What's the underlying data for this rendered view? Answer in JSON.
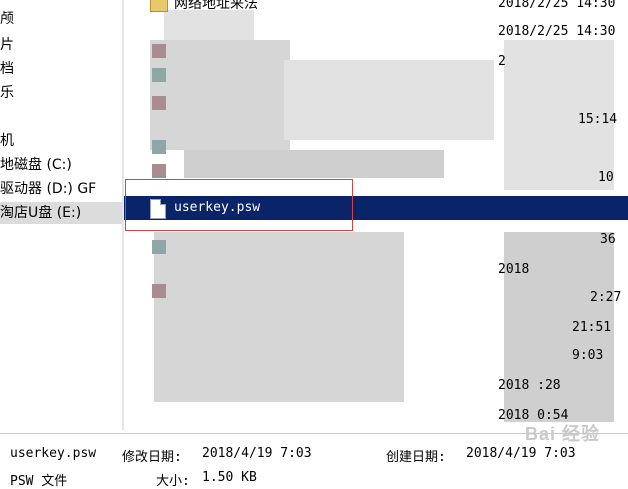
{
  "nav": {
    "items": [
      {
        "label": "颅"
      },
      {
        "label": "片"
      },
      {
        "label": "档"
      },
      {
        "label": "乐"
      },
      {
        "label": "机"
      },
      {
        "label": "地磁盘 (C:)"
      },
      {
        "label": "驱动器 (D:) GF"
      },
      {
        "label": "淘店U盘 (E:)"
      }
    ]
  },
  "files": {
    "rows": [
      {
        "name": "网络地址来法",
        "date": "2018/2/25 14:30"
      },
      {
        "name": "",
        "date": "2018/2/25 14:30"
      },
      {
        "name": "",
        "date": "2"
      },
      {
        "name": "",
        "date": "15:14"
      },
      {
        "name": "",
        "date": "10"
      },
      {
        "name": "userkey.psw",
        "date": ""
      },
      {
        "name": "",
        "date": "36"
      },
      {
        "name": "",
        "date": "2018"
      },
      {
        "name": "",
        "date": "2:27"
      },
      {
        "name": "",
        "date": "21:51"
      },
      {
        "name": "",
        "date": "9:03"
      },
      {
        "name": "",
        "date": "2018 :28"
      },
      {
        "name": "",
        "date": "2018 0:54"
      }
    ]
  },
  "status": {
    "filename": "userkey.psw",
    "modified_label": "修改日期:",
    "modified_value": "2018/4/19 7:03",
    "created_label": "创建日期:",
    "created_value": "2018/4/19 7:03",
    "type": "PSW 文件",
    "size_label": "大小:",
    "size_value": "1.50 KB"
  },
  "watermark": "Bai 经验"
}
